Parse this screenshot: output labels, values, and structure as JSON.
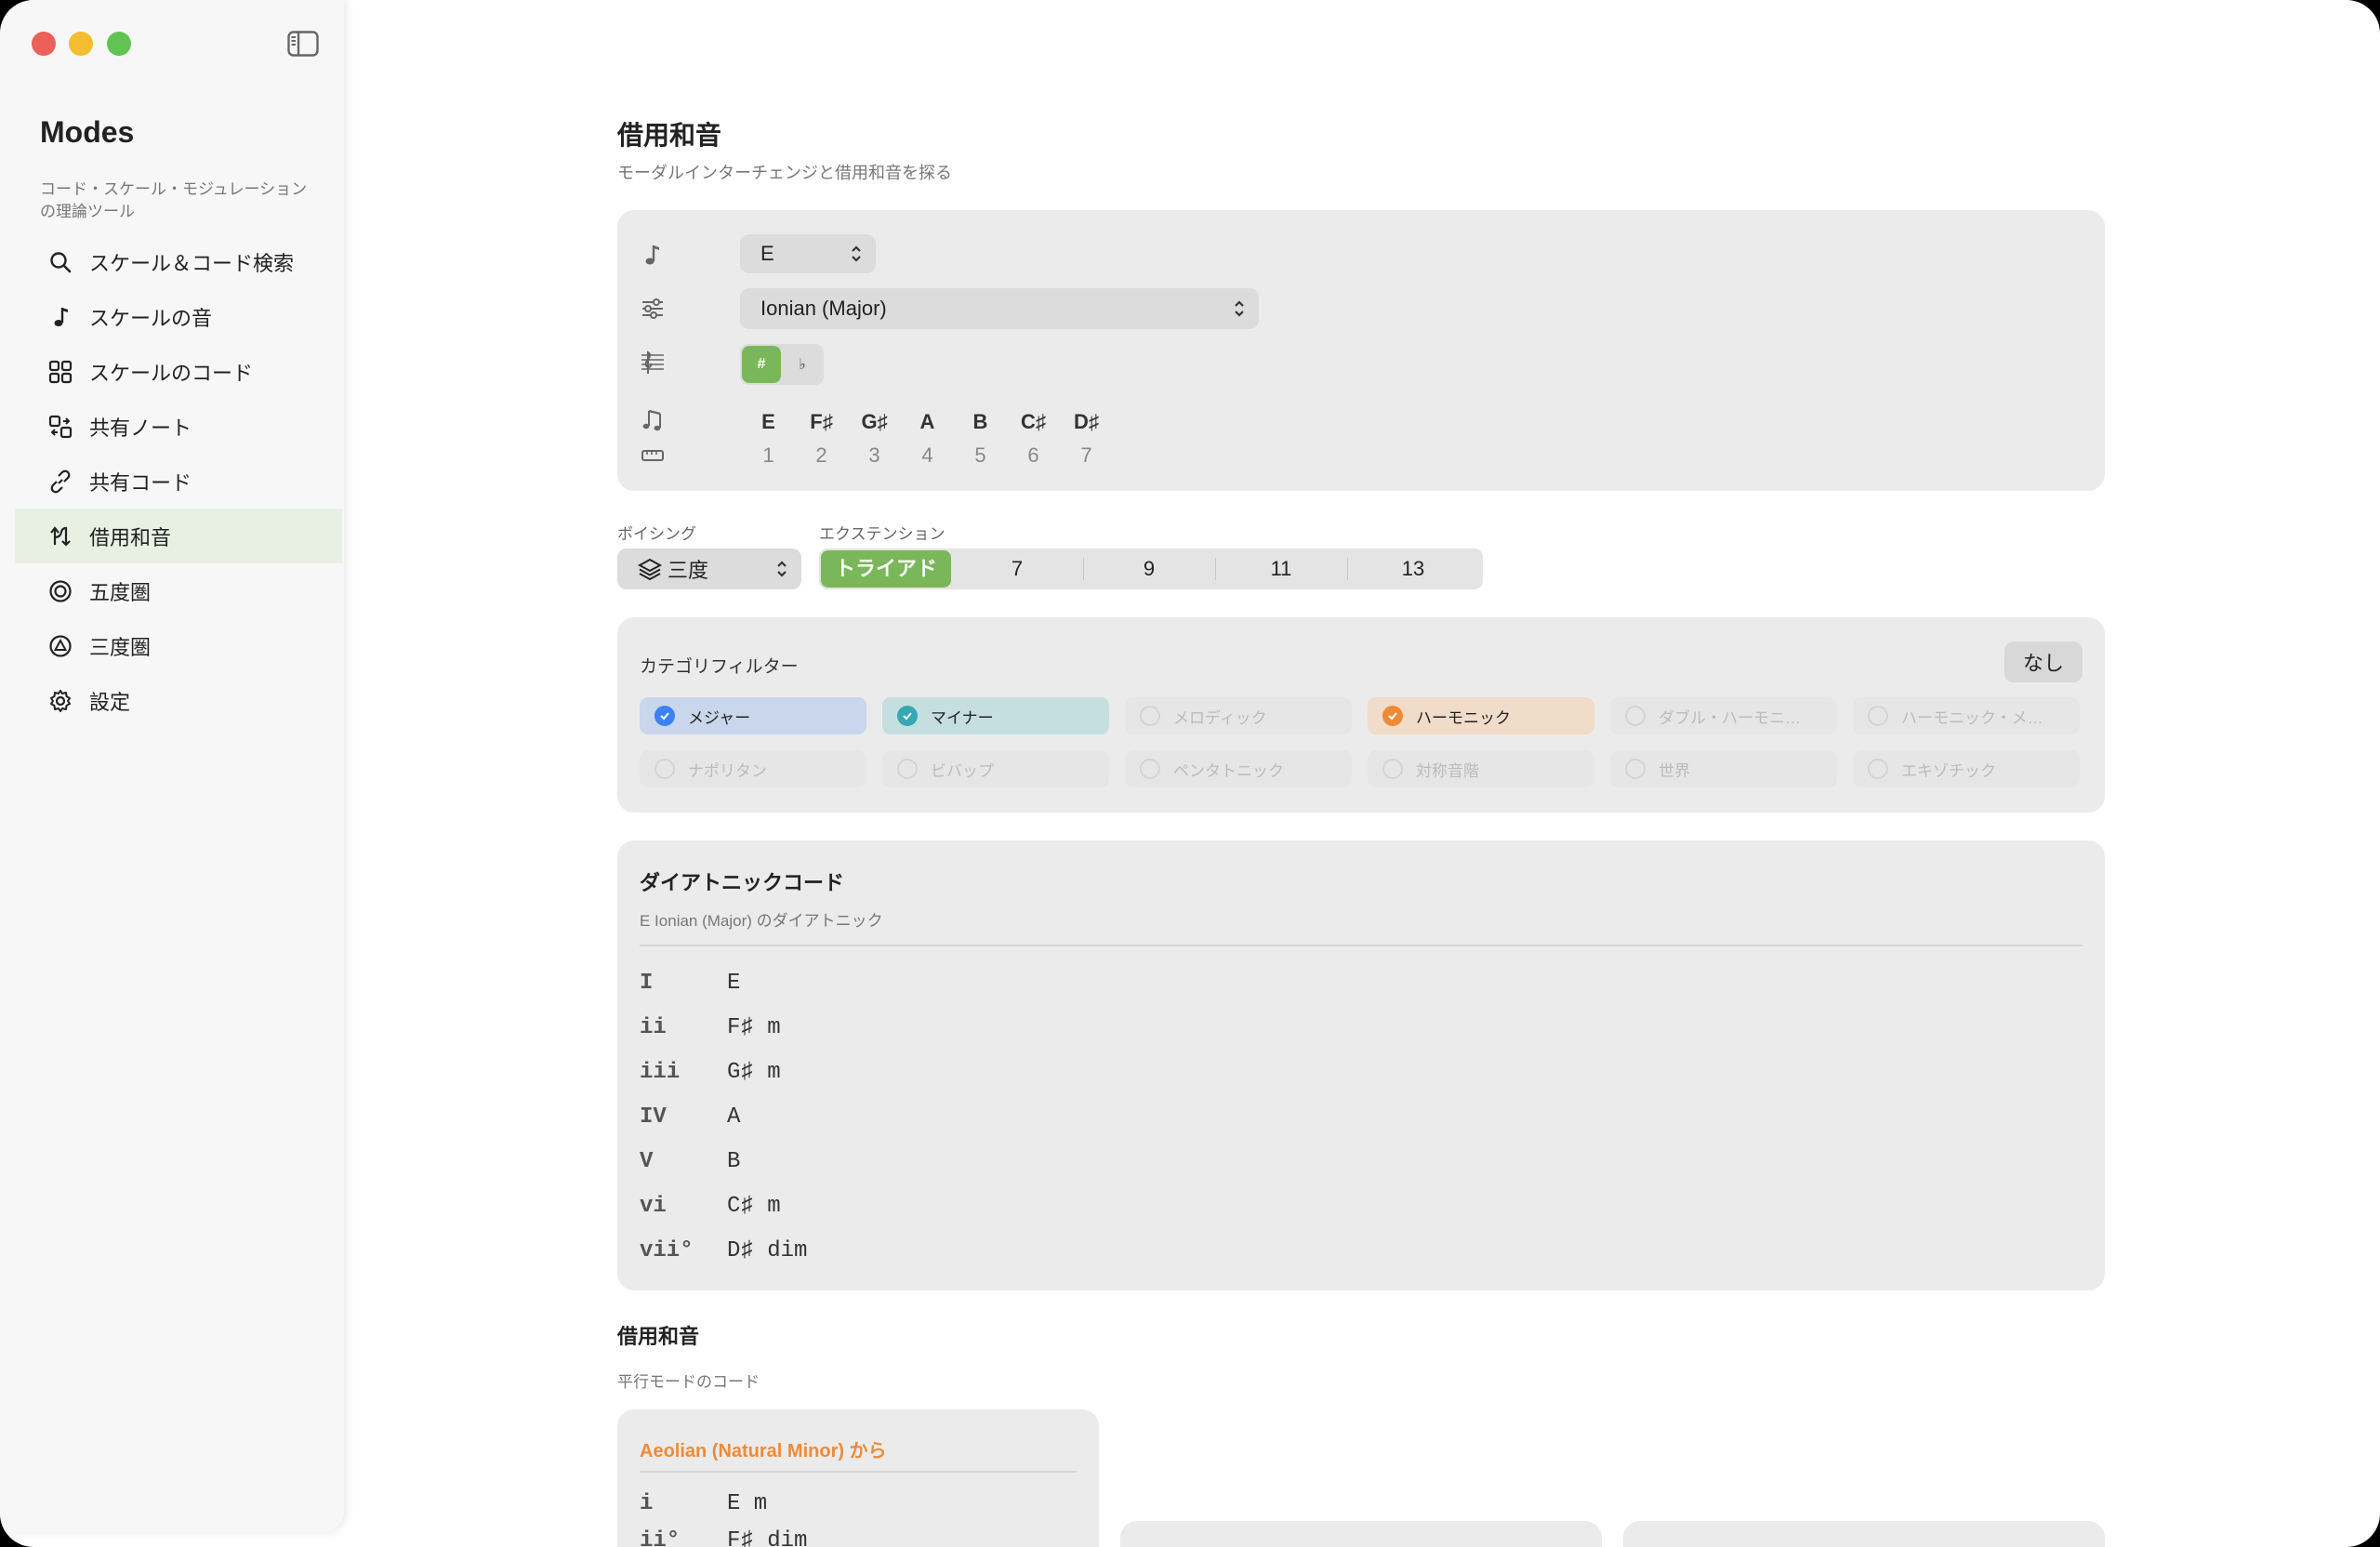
{
  "app": {
    "title": "Modes",
    "subtitle": "コード・スケール・モジュレーションの理論ツール"
  },
  "sidebar": {
    "items": [
      {
        "label": "スケール＆コード検索",
        "icon": "search-icon"
      },
      {
        "label": "スケールの音",
        "icon": "music-note-icon"
      },
      {
        "label": "スケールのコード",
        "icon": "grid-icon"
      },
      {
        "label": "共有ノート",
        "icon": "shapes-icon"
      },
      {
        "label": "共有コード",
        "icon": "link-icon"
      },
      {
        "label": "借用和音",
        "icon": "borrow-arrows-icon",
        "active": true
      },
      {
        "label": "五度圏",
        "icon": "circle-icon"
      },
      {
        "label": "三度圏",
        "icon": "triangle-circle-icon"
      },
      {
        "label": "設定",
        "icon": "gear-icon"
      }
    ]
  },
  "page": {
    "title": "借用和音",
    "subtitle": "モーダルインターチェンジと借用和音を探る"
  },
  "settings": {
    "key": "E",
    "mode": "Ionian (Major)",
    "sharp_label": "#",
    "flat_label": "♭",
    "notes": [
      {
        "name": "E",
        "degree": "1"
      },
      {
        "name": "F♯",
        "degree": "2"
      },
      {
        "name": "G♯",
        "degree": "3"
      },
      {
        "name": "A",
        "degree": "4"
      },
      {
        "name": "B",
        "degree": "5"
      },
      {
        "name": "C♯",
        "degree": "6"
      },
      {
        "name": "D♯",
        "degree": "7"
      }
    ]
  },
  "voicing": {
    "label": "ボイシング",
    "value": "三度"
  },
  "extension": {
    "label": "エクステンション",
    "options": [
      "トライアド",
      "7",
      "9",
      "11",
      "13"
    ],
    "selected": "トライアド"
  },
  "category_filter": {
    "title": "カテゴリフィルター",
    "none_label": "なし",
    "chips": [
      {
        "label": "メジャー",
        "checked": true,
        "color": "#c9d6ec",
        "check_color": "#3b82f6"
      },
      {
        "label": "マイナー",
        "checked": true,
        "color": "#c5dfe0",
        "check_color": "#35a7b5"
      },
      {
        "label": "メロディック",
        "checked": false
      },
      {
        "label": "ハーモニック",
        "checked": true,
        "color": "#f1dcc9",
        "check_color": "#ee8a37"
      },
      {
        "label": "ダブル・ハーモニ…",
        "checked": false
      },
      {
        "label": "ハーモニック・メ…",
        "checked": false
      },
      {
        "label": "ナポリタン",
        "checked": false
      },
      {
        "label": "ビバップ",
        "checked": false
      },
      {
        "label": "ペンタトニック",
        "checked": false
      },
      {
        "label": "対称音階",
        "checked": false
      },
      {
        "label": "世界",
        "checked": false
      },
      {
        "label": "エキゾチック",
        "checked": false
      }
    ]
  },
  "diatonic": {
    "title": "ダイアトニックコード",
    "subtitle": "E Ionian (Major) のダイアトニック",
    "chords": [
      {
        "numeral": "I",
        "chord": "E"
      },
      {
        "numeral": "ii",
        "chord": "F♯ m"
      },
      {
        "numeral": "iii",
        "chord": "G♯ m"
      },
      {
        "numeral": "IV",
        "chord": "A"
      },
      {
        "numeral": "V",
        "chord": "B"
      },
      {
        "numeral": "vi",
        "chord": "C♯ m"
      },
      {
        "numeral": "vii°",
        "chord": "D♯ dim"
      }
    ]
  },
  "borrowed": {
    "title": "借用和音",
    "subtitle": "平行モードのコード",
    "cards": [
      {
        "from": "Aeolian (Natural Minor) から",
        "from_color": "#ee8a37",
        "chords": [
          {
            "numeral": "i",
            "chord": "E m"
          },
          {
            "numeral": "ii°",
            "chord": "F♯ dim"
          }
        ]
      }
    ]
  }
}
